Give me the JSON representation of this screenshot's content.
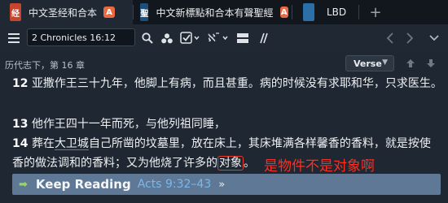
{
  "tabs": [
    {
      "title": "中文圣经和合本",
      "badge": "A",
      "thumb_color": "#c7452e",
      "active": true
    },
    {
      "title": "中文新標點和合本有聲聖經",
      "badge": "A",
      "thumb_color": "#1e4f7a",
      "active": false
    },
    {
      "title": "LBD",
      "thumb_color": "#2c6fa8",
      "active": false
    }
  ],
  "add_tab_symbol": "+",
  "toolbar": {
    "reference_value": "2 Chronicles 16:12",
    "icons": [
      "menu-icon",
      "search-icon",
      "cluster-icon",
      "check-icon",
      "interlinear-icon",
      "layout-icon",
      "parallel-icon",
      "back-icon",
      "forward-icon",
      "more-icon"
    ]
  },
  "breadcrumb": "历代志下，第 16 章",
  "verse_select": "Verse",
  "verses": [
    {
      "num": "12",
      "text": "亚撒作王三十九年，他脚上有病，而且甚重。病的时候没有求耶和华，只求医生。"
    },
    {
      "num": "13",
      "text": "他作王四十一年而死，与他列祖同睡，"
    },
    {
      "num": "14",
      "line1_before": "葬在",
      "line1_ul1": "大卫城",
      "line1_mid": "自己所凿的坟墓里，放在床上，其床堆满各样馨香的香料，就是按使",
      "line2_before": "香的做法调和的香料；又为他烧了许多的",
      "line2_boxed": "对象",
      "line2_after": "。"
    }
  ],
  "annotation": "是物件不是对象啊",
  "annotation_color": "#ff2d1f",
  "keep_reading": {
    "label": "Keep Reading",
    "ref": "Acts 9:32–43",
    "more": "»"
  }
}
